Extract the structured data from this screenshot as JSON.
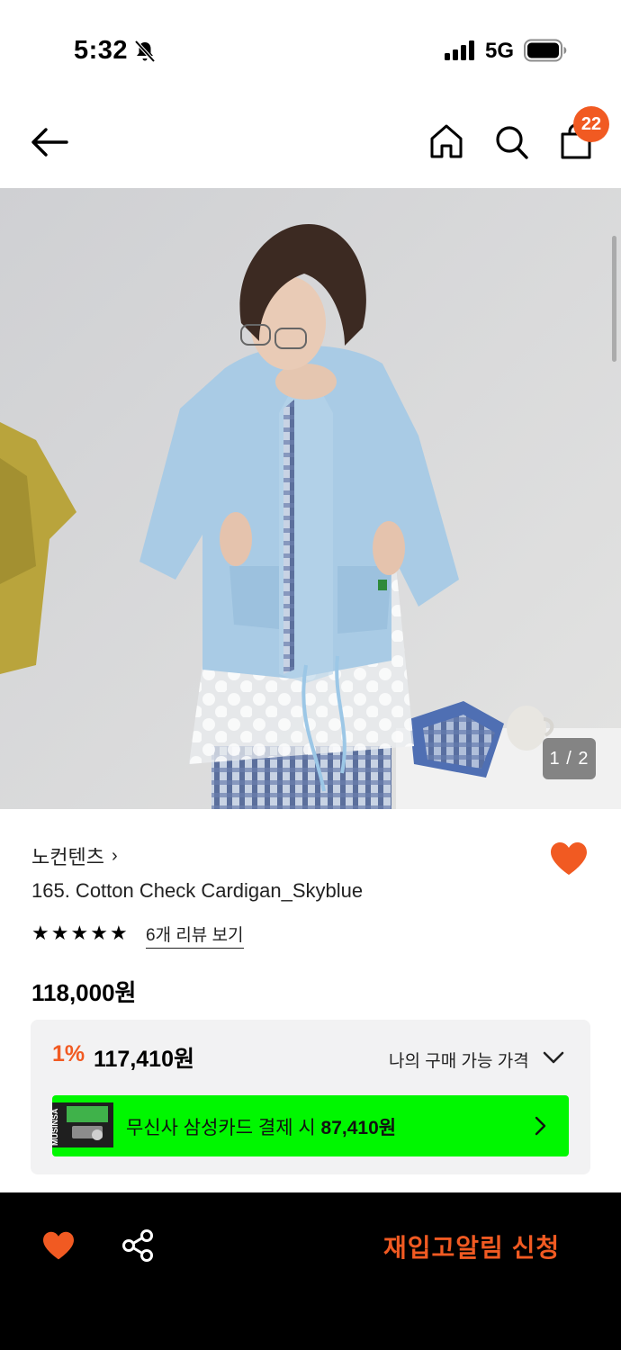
{
  "status_bar": {
    "time": "5:32",
    "network": "5G"
  },
  "nav": {
    "cart_count": "22"
  },
  "gallery": {
    "counter": "1 / 2"
  },
  "product": {
    "brand": "노컨텐츠",
    "brand_chevron": "›",
    "name": "165. Cotton Check Cardigan_Skyblue",
    "rating_stars": 5,
    "reviews_link": "6개 리뷰 보기",
    "price": "118,000원"
  },
  "benefit": {
    "discount_pct": "1%",
    "discount_price": "117,410원",
    "my_price_label": "나의 구매 가능 가격",
    "promo_prefix": "무신사 삼성카드 결제 시 ",
    "promo_price": "87,410원",
    "promo_card_text": "MUSINSA"
  },
  "bottom_bar": {
    "cta": "재입고알림 신청"
  },
  "colors": {
    "accent": "#f15a22",
    "promo": "#00f700",
    "bottom": "#000000"
  }
}
